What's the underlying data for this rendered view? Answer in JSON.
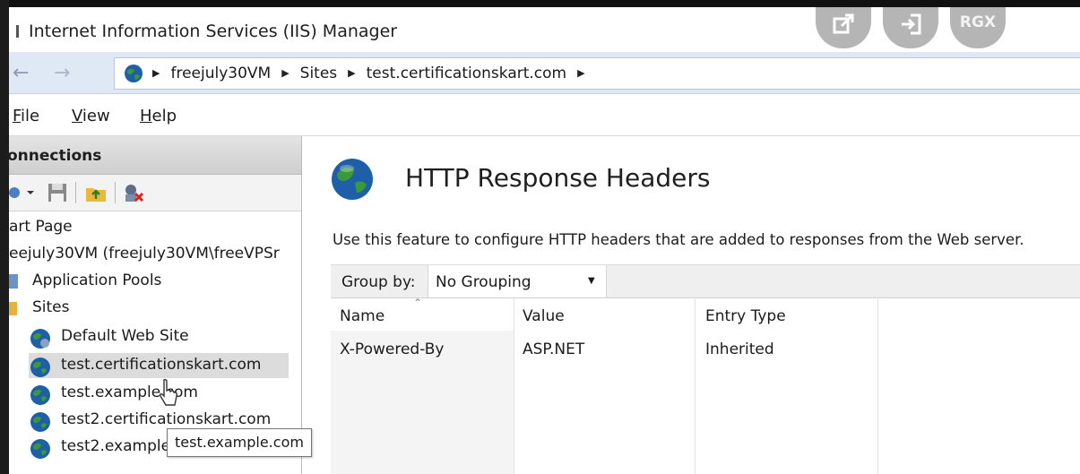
{
  "window": {
    "title": "Internet Information Services (IIS) Manager",
    "overlay_label": "RGX"
  },
  "address": {
    "crumbs": [
      "freejuly30VM",
      "Sites",
      "test.certificationskart.com"
    ]
  },
  "menu": {
    "file": "File",
    "view": "View",
    "help": "Help"
  },
  "connections": {
    "header": "onnections",
    "tree": {
      "start_page": "art Page",
      "server": "eejuly30VM (freejuly30VM\\freeVPSr",
      "app_pools": "Application Pools",
      "sites": "Sites",
      "site_items": [
        "Default Web Site",
        "test.certificationskart.com",
        "test.example.com",
        "test2.certificationskart.com",
        "test2.example"
      ]
    },
    "tooltip": "test.example.com"
  },
  "main": {
    "title": "HTTP Response Headers",
    "description": "Use this feature to configure HTTP headers that are added to responses from the Web server.",
    "group_by_label": "Group by:",
    "group_by_value": "No Grouping",
    "columns": [
      "Name",
      "Value",
      "Entry Type"
    ],
    "rows": [
      {
        "name": "X-Powered-By",
        "value": "ASP.NET",
        "entry_type": "Inherited"
      }
    ]
  },
  "colors": {
    "address_bar": "#dfe9f5",
    "selection": "#dcdcdc",
    "globe_blue": "#1e5fa8",
    "globe_green": "#3a9a3a"
  }
}
